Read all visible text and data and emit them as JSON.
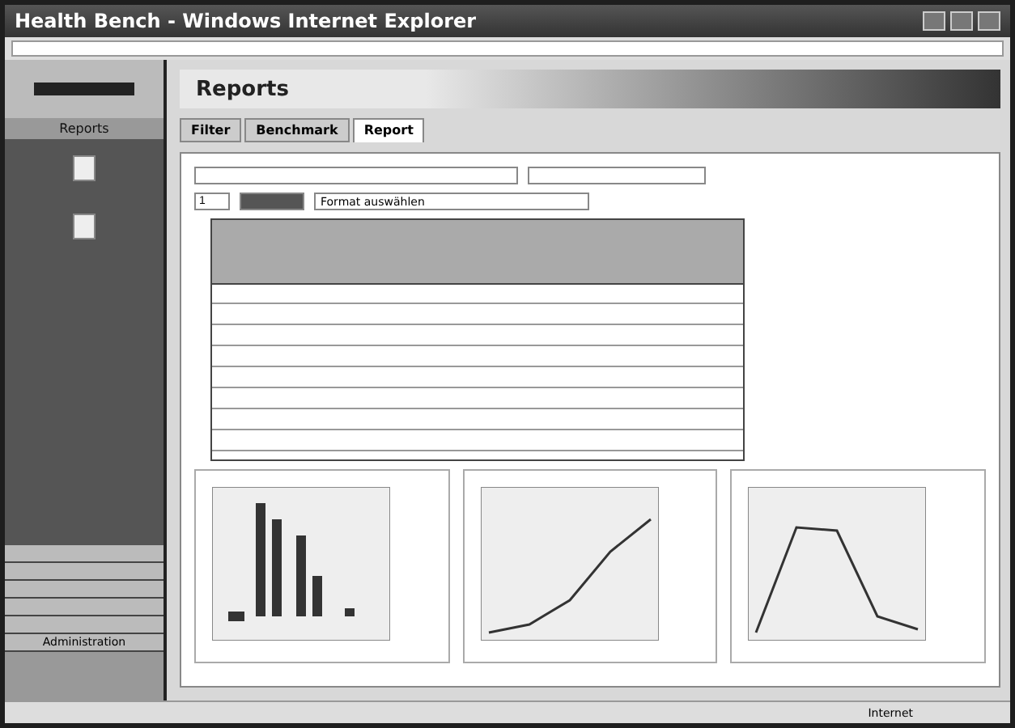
{
  "window": {
    "title": "Health Bench - Windows Internet Explorer"
  },
  "sidebar": {
    "items": [
      {
        "label": "Reports",
        "selected": true
      }
    ],
    "menu": [
      {
        "label": "Administration"
      }
    ]
  },
  "page": {
    "title": "Reports"
  },
  "tabs": [
    {
      "label": "Filter",
      "selected": false
    },
    {
      "label": "Benchmark",
      "selected": false
    },
    {
      "label": "Report",
      "selected": true
    }
  ],
  "toolbar": {
    "page_field": "1",
    "format_placeholder": "Format auswählen"
  },
  "status_bar": {
    "zone": "Internet"
  }
}
